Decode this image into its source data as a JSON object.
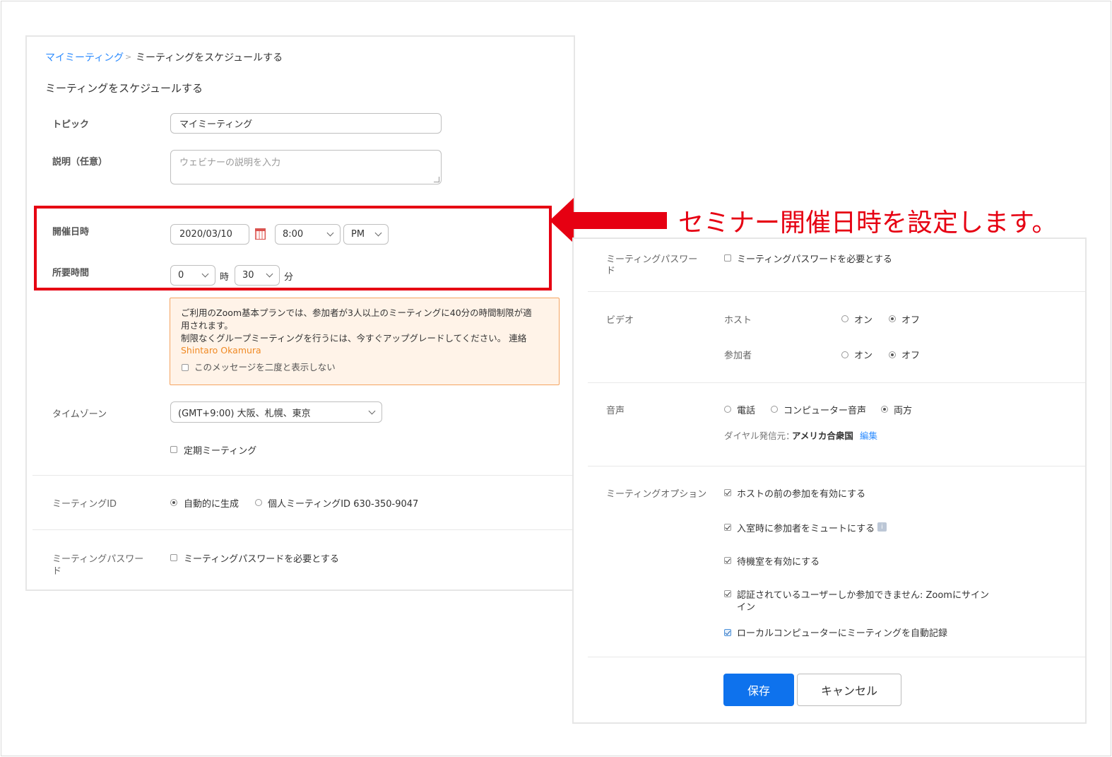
{
  "breadcrumb": {
    "parent": "マイミーティング",
    "separator": ">",
    "current": "ミーティングをスケジュールする"
  },
  "page_title": "ミーティングをスケジュールする",
  "topic": {
    "label": "トピック",
    "value": "マイミーティング"
  },
  "description": {
    "label": "説明（任意）",
    "placeholder": "ウェビナーの説明を入力"
  },
  "datetime": {
    "label": "開催日時",
    "date": "2020/03/10",
    "time": "8:00",
    "ampm": "PM"
  },
  "duration": {
    "label": "所要時間",
    "hours": "0",
    "hours_unit": "時",
    "minutes": "30",
    "minutes_unit": "分"
  },
  "warning": {
    "line1": "ご利用のZoom基本プランでは、参加者が3人以上のミーティングに40分の時間制限が適",
    "line2": "用されます。",
    "line3": "制限なくグループミーティングを行うには、今すぐアップグレードしてください。 連絡",
    "contact": "Shintaro Okamura",
    "dont_show": "このメッセージを二度と表示しない"
  },
  "timezone": {
    "label": "タイムゾーン",
    "value": "(GMT+9:00) 大阪、札幌、東京"
  },
  "recurring": {
    "label": "定期ミーティング"
  },
  "meeting_id": {
    "label": "ミーティングID",
    "option_auto": "自動的に生成",
    "option_personal": "個人ミーティングID 630-350-9047"
  },
  "password_left": {
    "label_line1": "ミーティングパスワー",
    "label_line2": "ド",
    "checkbox": "ミーティングパスワードを必要とする"
  },
  "callout": {
    "text": "セミナー開催日時を設定します。"
  },
  "password_right": {
    "label_line1": "ミーティングパスワー",
    "label_line2": "ド",
    "checkbox": "ミーティングパスワードを必要とする"
  },
  "video": {
    "label": "ビデオ",
    "host_label": "ホスト",
    "participant_label": "参加者",
    "on": "オン",
    "off": "オフ"
  },
  "audio": {
    "label": "音声",
    "phone": "電話",
    "computer": "コンピューター音声",
    "both": "両方",
    "dial_from_label": "ダイヤル発信元：",
    "dial_from_value": "アメリカ合衆国",
    "edit": "編集"
  },
  "options": {
    "label": "ミーティングオプション",
    "join_before_host": "ホストの前の参加を有効にする",
    "mute_on_entry": "入室時に参加者をミュートにする",
    "waiting_room": "待機室を有効にする",
    "auth_line1": "認証されているユーザーしか参加できません: Zoomにサイン",
    "auth_line2": "イン",
    "auto_record": "ローカルコンピューターにミーティングを自動記録"
  },
  "buttons": {
    "save": "保存",
    "cancel": "キャンセル"
  },
  "colors": {
    "accent": "#0e72ed",
    "link": "#2d8cff",
    "highlight": "#e60012",
    "warning_border": "#f5a461",
    "warning_bg": "#fff3e8"
  }
}
